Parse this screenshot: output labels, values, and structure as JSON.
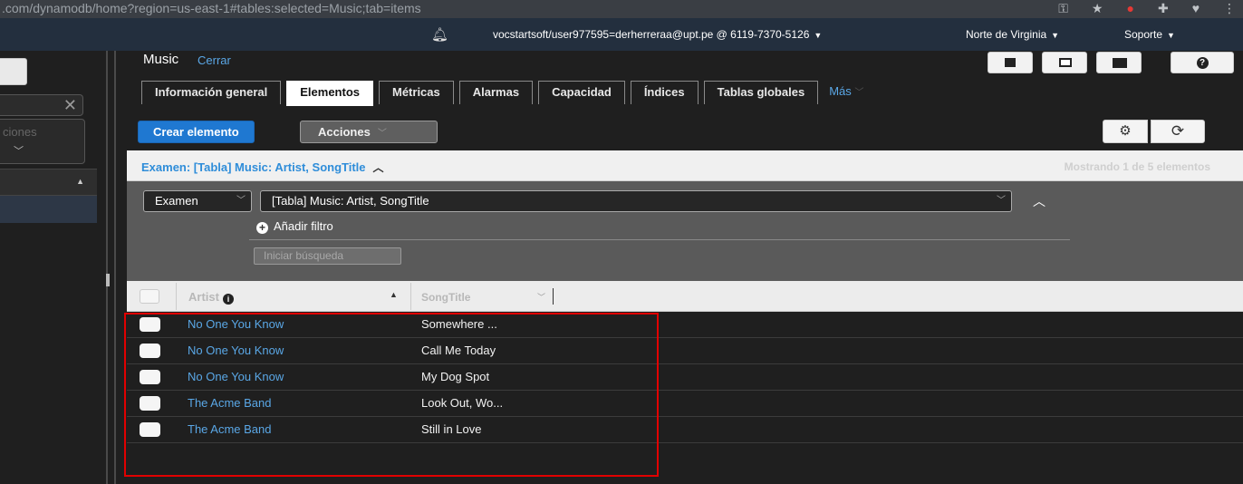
{
  "browser": {
    "url": ".com/dynamodb/home?region=us-east-1#tables:selected=Music;tab=items"
  },
  "topnav": {
    "account": "vocstartsoft/user977595=derherreraa@upt.pe @ 6119-7370-5126",
    "region": "Norte de Virginia",
    "support": "Soporte"
  },
  "sidebar": {
    "accordion_text": "ciones"
  },
  "main": {
    "title": "Music",
    "close": "Cerrar",
    "tabs": [
      {
        "label": "Información general"
      },
      {
        "label": "Elementos"
      },
      {
        "label": "Métricas"
      },
      {
        "label": "Alarmas"
      },
      {
        "label": "Capacidad"
      },
      {
        "label": "Índices"
      },
      {
        "label": "Tablas globales"
      },
      {
        "label": "Más"
      }
    ],
    "create_label": "Crear elemento",
    "actions_label": "Acciones"
  },
  "scan": {
    "header": "Examen: [Tabla] Music: Artist, SongTitle",
    "count": "Mostrando 1 de 5 elementos",
    "operation": "Examen",
    "table": "[Tabla] Music: Artist, SongTitle",
    "add_filter": "Añadir filtro",
    "start_search": "Iniciar búsqueda"
  },
  "table": {
    "columns": [
      "Artist",
      "SongTitle"
    ],
    "rows": [
      {
        "artist": "No One You Know",
        "song": "Somewhere ..."
      },
      {
        "artist": "No One You Know",
        "song": "Call Me Today"
      },
      {
        "artist": "No One You Know",
        "song": "My Dog Spot"
      },
      {
        "artist": "The Acme Band",
        "song": "Look Out, Wo..."
      },
      {
        "artist": "The Acme Band",
        "song": "Still in Love"
      }
    ]
  },
  "colors": {
    "accent_blue": "#1f78d1",
    "link_blue": "#5aa7e6",
    "highlight_red": "#e10000",
    "navbar": "#232f3e"
  }
}
